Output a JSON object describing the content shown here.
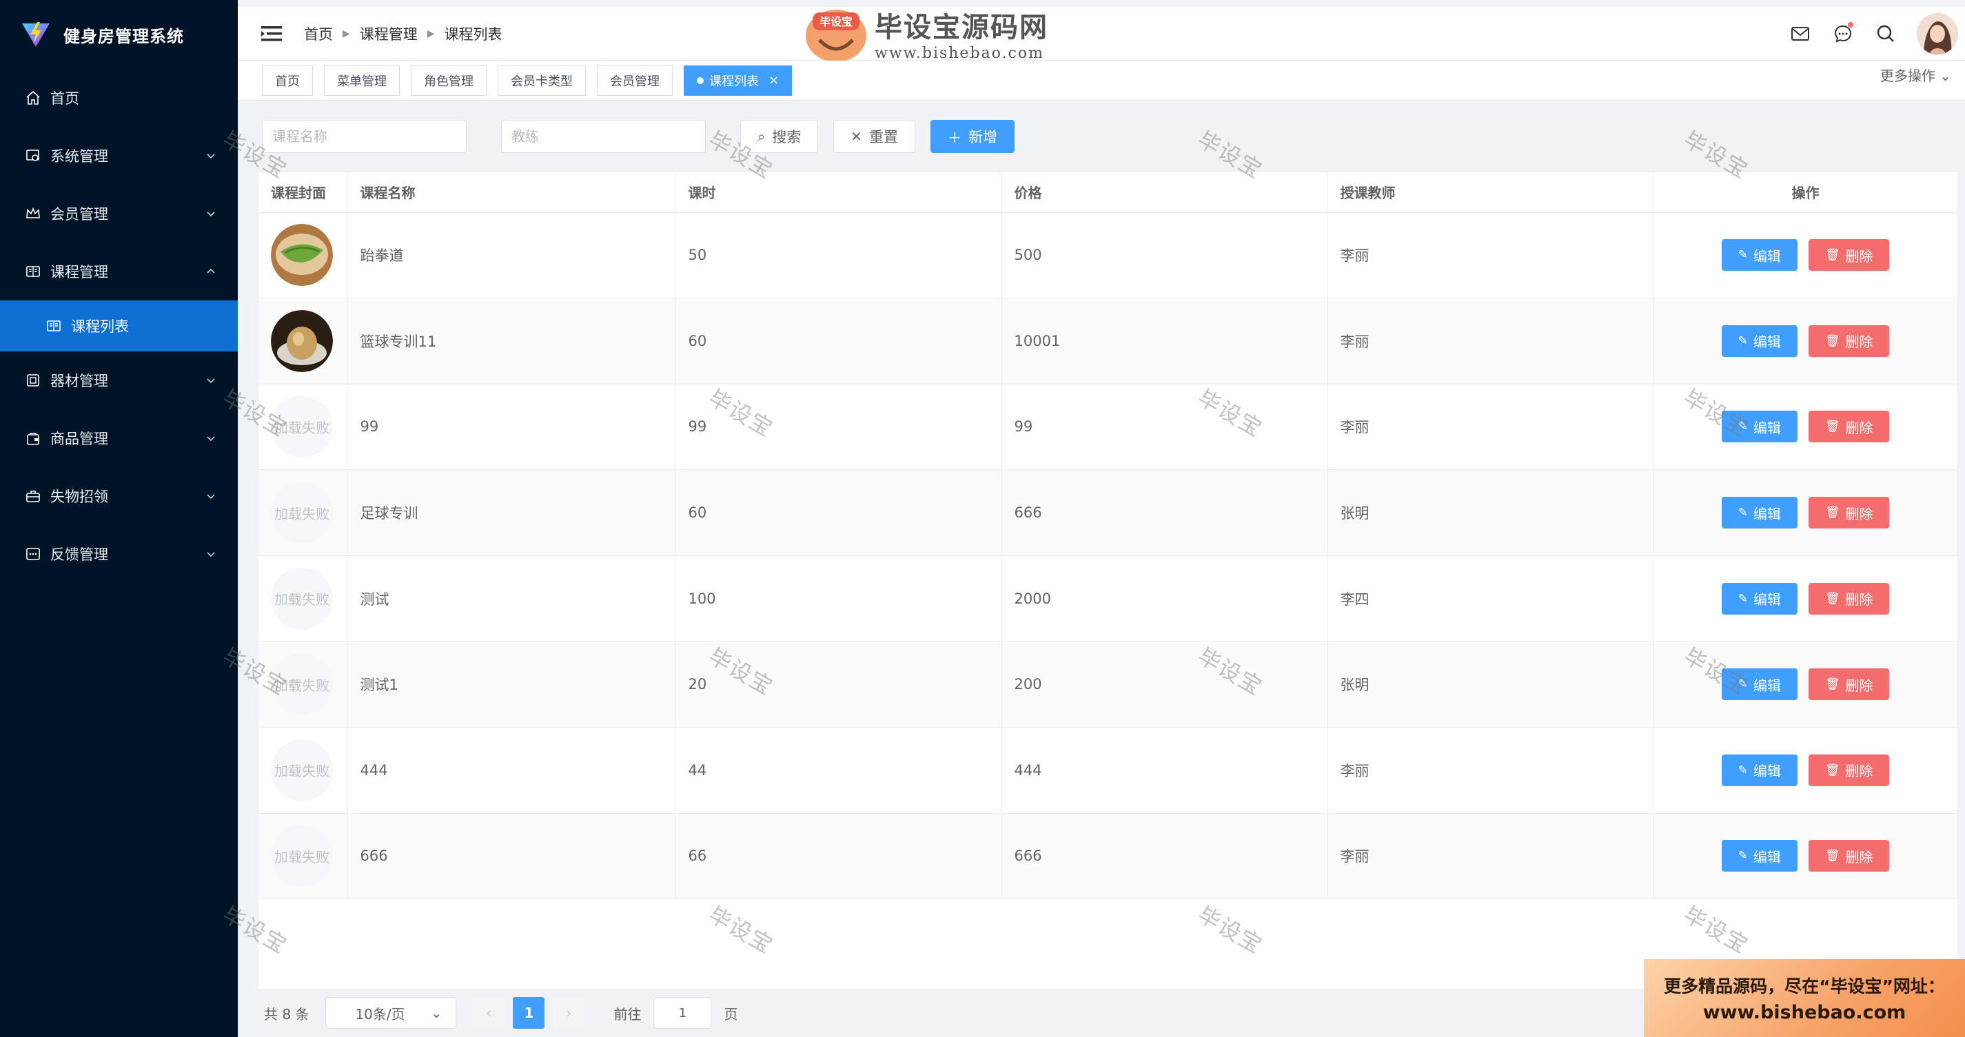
{
  "app": {
    "title": "健身房管理系统"
  },
  "sidebar": {
    "items": [
      {
        "label": "首页",
        "icon": "home-icon",
        "expandable": false
      },
      {
        "label": "系统管理",
        "icon": "system-icon",
        "expandable": true
      },
      {
        "label": "会员管理",
        "icon": "crown-icon",
        "expandable": true
      },
      {
        "label": "课程管理",
        "icon": "book-icon",
        "expandable": true,
        "expanded": true
      },
      {
        "label": "课程列表",
        "icon": "book-icon",
        "sub": true,
        "active": true
      },
      {
        "label": "器材管理",
        "icon": "equipment-icon",
        "expandable": true
      },
      {
        "label": "商品管理",
        "icon": "bag-icon",
        "expandable": true
      },
      {
        "label": "失物招领",
        "icon": "briefcase-icon",
        "expandable": true
      },
      {
        "label": "反馈管理",
        "icon": "feedback-icon",
        "expandable": true
      }
    ]
  },
  "header": {
    "breadcrumb": [
      "首页",
      "课程管理",
      "课程列表"
    ],
    "site_logo": {
      "badge": "毕设宝",
      "name": "毕设宝源码网",
      "url": "www.bishebao.com"
    }
  },
  "tabs": {
    "items": [
      "首页",
      "菜单管理",
      "角色管理",
      "会员卡类型",
      "会员管理",
      "课程列表"
    ],
    "active_index": 5,
    "more_ops": "更多操作"
  },
  "search": {
    "name_placeholder": "课程名称",
    "coach_placeholder": "教练",
    "search_label": "搜索",
    "reset_label": "重置",
    "add_label": "新增"
  },
  "table": {
    "columns": [
      "课程封面",
      "课程名称",
      "课时",
      "价格",
      "授课教师",
      "操作"
    ],
    "edit_label": "编辑",
    "delete_label": "删除",
    "fail_text": "加载失败",
    "rows": [
      {
        "cover": "image-green",
        "name": "跆拳道",
        "hours": "50",
        "price": "500",
        "teacher": "李丽"
      },
      {
        "cover": "image-brown",
        "name": "篮球专训11",
        "hours": "60",
        "price": "10001",
        "teacher": "李丽"
      },
      {
        "cover": "failed",
        "name": "99",
        "hours": "99",
        "price": "99",
        "teacher": "李丽"
      },
      {
        "cover": "failed",
        "name": "足球专训",
        "hours": "60",
        "price": "666",
        "teacher": "张明"
      },
      {
        "cover": "failed",
        "name": "测试",
        "hours": "100",
        "price": "2000",
        "teacher": "李四"
      },
      {
        "cover": "failed",
        "name": "测试1",
        "hours": "20",
        "price": "200",
        "teacher": "张明"
      },
      {
        "cover": "failed",
        "name": "444",
        "hours": "44",
        "price": "444",
        "teacher": "李丽"
      },
      {
        "cover": "failed",
        "name": "666",
        "hours": "66",
        "price": "666",
        "teacher": "李丽"
      }
    ]
  },
  "pager": {
    "total": "共 8 条",
    "page_size": "10条/页",
    "current": "1",
    "goto_label": "前往",
    "goto_value": "1",
    "page_unit": "页"
  },
  "banner": {
    "line1": "更多精品源码，尽在“毕设宝”网址：",
    "line2": "www.bishebao.com"
  },
  "watermark": "毕设宝",
  "colors": {
    "sidebar_bg": "#011326",
    "active_menu": "#0e70d3",
    "primary": "#409eff",
    "danger": "#f56c6c"
  }
}
